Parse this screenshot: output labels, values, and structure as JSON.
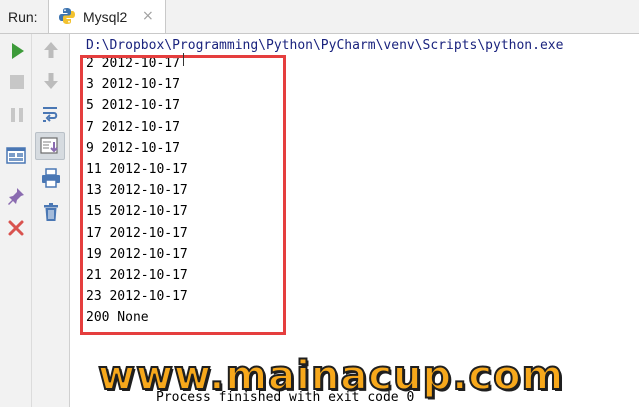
{
  "tabbar": {
    "run_label": "Run:",
    "tab_title": "Mysql2",
    "close_glyph": "×",
    "tab_icon": "python-icon"
  },
  "toolbar_left": [
    {
      "icon": "run-icon",
      "color": "#3d9b3a"
    },
    {
      "icon": "stop-icon",
      "color": "#b5b5b5"
    },
    {
      "icon": "pause-icon",
      "color": "#b5b5b5"
    },
    {
      "icon": "layout-icon",
      "color": "#4a77b4"
    },
    {
      "icon": "pin-icon",
      "color": "#8a6bb0"
    },
    {
      "icon": "close-icon",
      "color": "#d9534f"
    }
  ],
  "toolbar_right": [
    {
      "icon": "up-arrow-icon"
    },
    {
      "icon": "down-arrow-icon"
    },
    {
      "icon": "soft-wrap-icon"
    },
    {
      "icon": "scroll-to-end-icon"
    },
    {
      "icon": "print-icon"
    },
    {
      "icon": "trash-icon"
    }
  ],
  "console": {
    "path": "D:\\Dropbox\\Programming\\Python\\PyCharm\\venv\\Scripts\\python.exe",
    "lines": [
      "2 2012-10-17",
      "3 2012-10-17",
      "5 2012-10-17",
      "7 2012-10-17",
      "9 2012-10-17",
      "11 2012-10-17",
      "13 2012-10-17",
      "15 2012-10-17",
      "17 2012-10-17",
      "19 2012-10-17",
      "21 2012-10-17",
      "23 2012-10-17",
      "200 None"
    ],
    "process_text": "Process finished with exit code 0"
  },
  "watermark": "www.mainacup.com",
  "colors": {
    "highlight_border": "#e53e3e",
    "path_text": "#1a237e",
    "watermark_fill": "#f7a81b"
  }
}
